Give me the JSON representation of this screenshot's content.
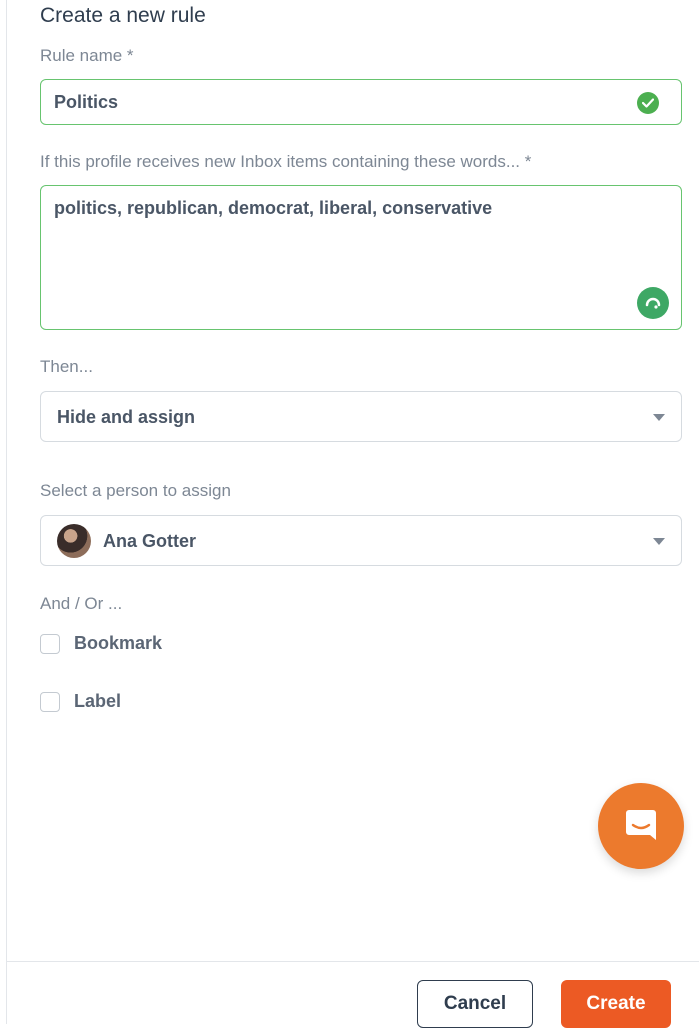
{
  "form": {
    "title": "Create a new rule",
    "rule_name_label": "Rule name *",
    "rule_name_value": "Politics",
    "keywords_label": "If this profile receives new Inbox items containing these words... *",
    "keywords_value": "politics, republican, democrat, liberal, conservative",
    "then_label": "Then...",
    "action_value": "Hide and assign",
    "assign_label": "Select a person to assign",
    "assignee_value": "Ana Gotter",
    "and_or_label": "And / Or ...",
    "options": [
      {
        "label": "Bookmark",
        "checked": false
      },
      {
        "label": "Label",
        "checked": false
      }
    ]
  },
  "footer": {
    "cancel_label": "Cancel",
    "create_label": "Create"
  },
  "colors": {
    "accent": "#ec5a24",
    "valid": "#67c46f",
    "chat": "#ec7a2d"
  }
}
